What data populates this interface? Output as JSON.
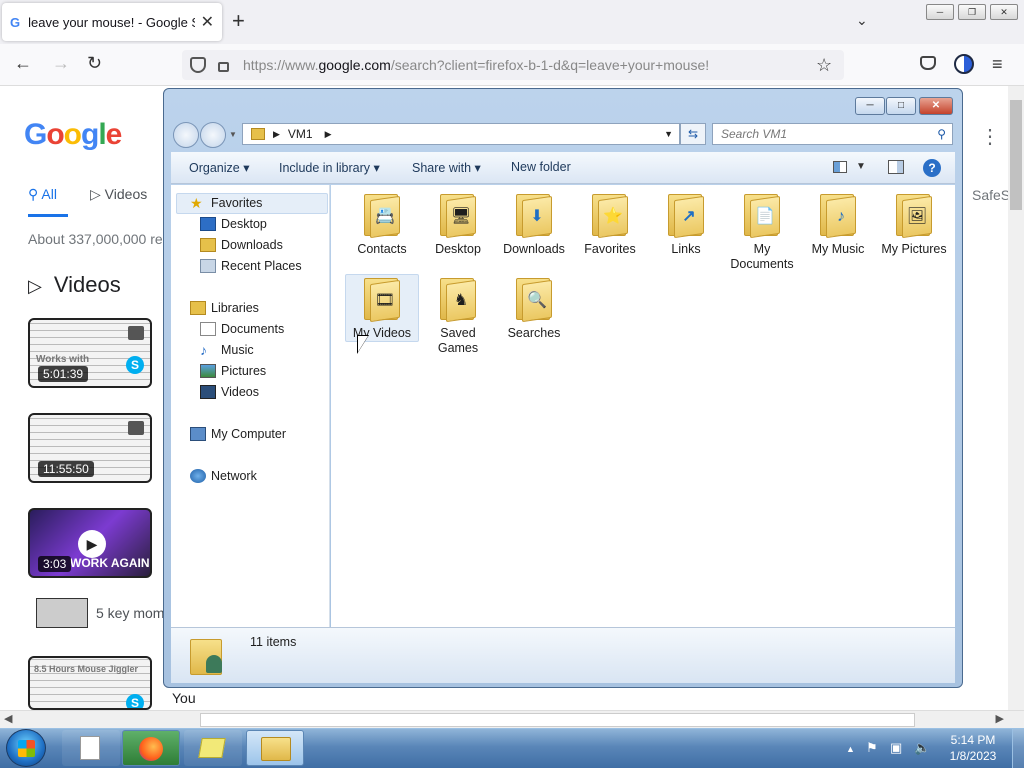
{
  "browser": {
    "tab_title": "leave your mouse! - Google Sea",
    "tab_favicon": "G",
    "close_tab": "✕",
    "new_tab": "+",
    "url_prefix": "https://www.",
    "url_domain": "google.com",
    "url_path": "/search?client=firefox-b-1-d&q=leave+your+mouse!"
  },
  "google": {
    "logo": [
      "G",
      "o",
      "o",
      "g",
      "l",
      "e"
    ],
    "logo_colors": [
      "#4285f4",
      "#ea4335",
      "#fbbc05",
      "#4285f4",
      "#34a853",
      "#ea4335"
    ],
    "tab_all": "All",
    "tab_videos": "Videos",
    "stats": "About 337,000,000 re",
    "safe": "SafeS",
    "videos_heading": "Videos",
    "video_durations": [
      "5:01:39",
      "11:55:50",
      "3:03"
    ],
    "video_text": [
      "Works with",
      "",
      "WORK AGAIN"
    ],
    "video5_title": "5 key mom",
    "video6_text": "8.5 Hours Mouse Jiggler",
    "you_partial": "You"
  },
  "explorer": {
    "address": "VM1",
    "search_placeholder": "Search VM1",
    "commands": {
      "organize": "Organize",
      "include_in_library": "Include in library",
      "share_with": "Share with",
      "new_folder": "New folder"
    },
    "nav": {
      "favorites": "Favorites",
      "desktop": "Desktop",
      "downloads": "Downloads",
      "recent_places": "Recent Places",
      "libraries": "Libraries",
      "documents": "Documents",
      "music": "Music",
      "pictures": "Pictures",
      "videos": "Videos",
      "my_computer": "My Computer",
      "network": "Network"
    },
    "folders": [
      {
        "label": "Contacts",
        "icon": "📇"
      },
      {
        "label": "Desktop",
        "icon": "🖥"
      },
      {
        "label": "Downloads",
        "icon": "⬇"
      },
      {
        "label": "Favorites",
        "icon": "⭐"
      },
      {
        "label": "Links",
        "icon": "↗"
      },
      {
        "label": "My Documents",
        "icon": "📄"
      },
      {
        "label": "My Music",
        "icon": "♪"
      },
      {
        "label": "My Pictures",
        "icon": "🖼"
      },
      {
        "label": "My Videos",
        "icon": "🎞"
      },
      {
        "label": "Saved Games",
        "icon": "♞"
      },
      {
        "label": "Searches",
        "icon": "🔍"
      }
    ],
    "item_count": "11 items"
  },
  "taskbar": {
    "time": "5:14 PM",
    "date": "1/8/2023"
  }
}
